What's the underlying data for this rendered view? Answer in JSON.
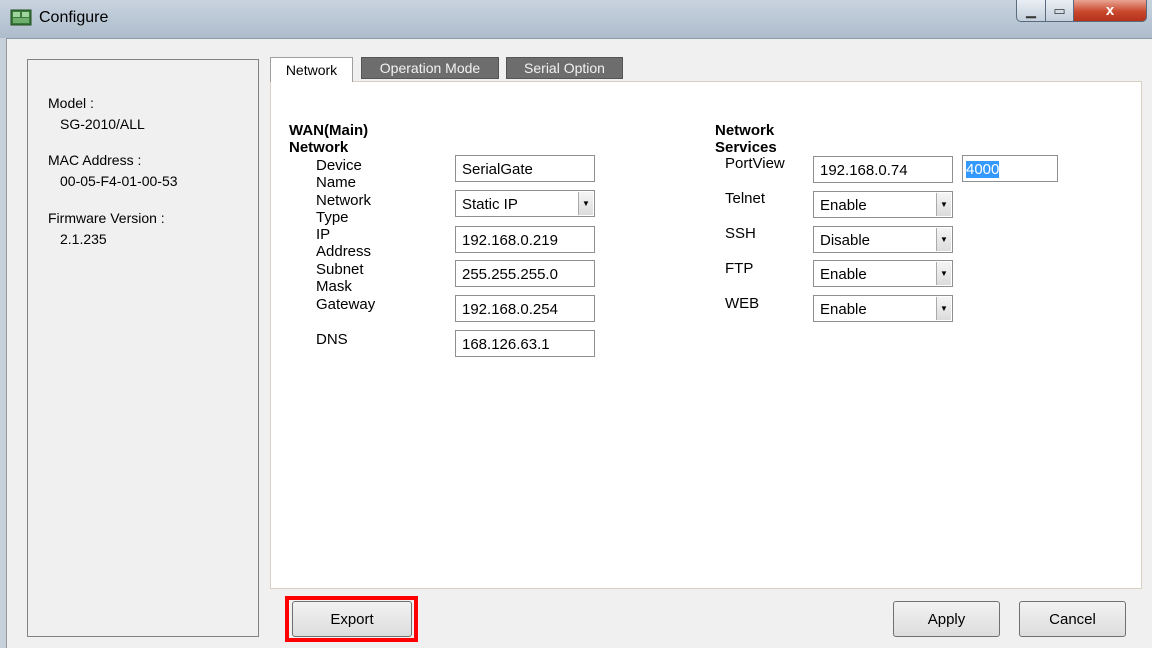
{
  "window": {
    "title": "Configure",
    "close_glyph": "x",
    "minimize_glyph": "▁",
    "maximize_glyph": "▭"
  },
  "info": {
    "model_label": "Model :",
    "model_value": "SG-2010/ALL",
    "mac_label": "MAC Address :",
    "mac_value": "00-05-F4-01-00-53",
    "firmware_label": "Firmware Version :",
    "firmware_value": "2.1.235"
  },
  "tabs": [
    {
      "label": "Network",
      "active": true
    },
    {
      "label": "Operation Mode",
      "active": false
    },
    {
      "label": "Serial Option",
      "active": false
    }
  ],
  "wan": {
    "title": "WAN(Main) Network",
    "device_name": {
      "label": "Device Name",
      "value": "SerialGate"
    },
    "network_type": {
      "label": "Network Type",
      "value": "Static IP"
    },
    "ip_address": {
      "label": "IP Address",
      "value": "192.168.0.219"
    },
    "subnet_mask": {
      "label": "Subnet Mask",
      "value": "255.255.255.0"
    },
    "gateway": {
      "label": "Gateway",
      "value": "192.168.0.254"
    },
    "dns": {
      "label": "DNS",
      "value": "168.126.63.1"
    }
  },
  "services": {
    "title": "Network Services",
    "portview": {
      "label": "PortView",
      "ip": "192.168.0.74",
      "port": "4000"
    },
    "telnet": {
      "label": "Telnet",
      "value": "Enable"
    },
    "ssh": {
      "label": "SSH",
      "value": "Disable"
    },
    "ftp": {
      "label": "FTP",
      "value": "Enable"
    },
    "web": {
      "label": "WEB",
      "value": "Enable"
    }
  },
  "buttons": {
    "export": "Export",
    "apply": "Apply",
    "cancel": "Cancel"
  },
  "colors": {
    "highlight": "#ff0000",
    "selection": "#3399ff"
  }
}
